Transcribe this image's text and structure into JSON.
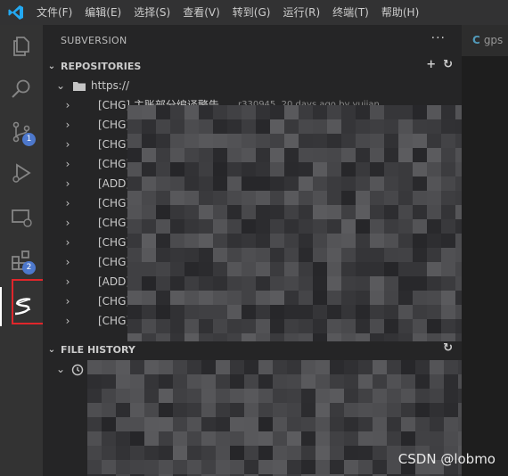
{
  "menu": [
    "文件(F)",
    "编辑(E)",
    "选择(S)",
    "查看(V)",
    "转到(G)",
    "运行(R)",
    "终端(T)",
    "帮助(H)"
  ],
  "activity": {
    "scm_badge": "1",
    "ext_badge": "2"
  },
  "sidebar": {
    "title": "SUBVERSION",
    "more": "···",
    "repositories": {
      "header": "REPOSITORIES",
      "repo_url": "https://",
      "commits": [
        {
          "label": "[CHG] 主账部分编译警告",
          "meta": "r330945, 20 days ago by yujian"
        },
        {
          "label": "[CHG]",
          "meta": ""
        },
        {
          "label": "[CHG]",
          "meta": ""
        },
        {
          "label": "[CHG]",
          "meta": ""
        },
        {
          "label": "[ADD]",
          "meta": ""
        },
        {
          "label": "[CHG]",
          "meta": ""
        },
        {
          "label": "[CHG]",
          "meta": ""
        },
        {
          "label": "[CHG]",
          "meta": ""
        },
        {
          "label": "[CHG]",
          "meta": ""
        },
        {
          "label": "[ADD]",
          "meta": ""
        },
        {
          "label": "[CHG]",
          "meta": ""
        },
        {
          "label": "[CHG]",
          "meta": ""
        }
      ]
    },
    "file_history": {
      "header": "FILE HISTORY"
    }
  },
  "editor": {
    "tab_label": "gps"
  },
  "watermark": "CSDN @lobmo",
  "colors": {
    "accent": "#4d78cc",
    "highlight": "#e0262b",
    "sidebar_bg": "#252526",
    "activity_bg": "#333333"
  }
}
